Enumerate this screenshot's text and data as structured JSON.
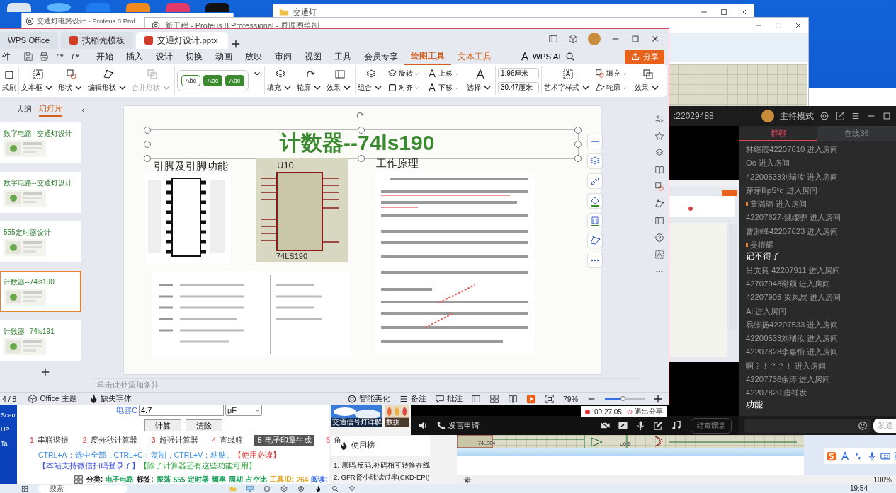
{
  "back_windows": [
    {
      "title": "交通灯电路设计 - Proteus 8 Prof"
    },
    {
      "title": "交通灯"
    },
    {
      "title": "新工程 - Proteus 8 Professional - 原理图绘制"
    }
  ],
  "desktop": {
    "icons": [
      {
        "label": "Scan"
      },
      {
        "label": "HP"
      },
      {
        "label": "Ta"
      }
    ]
  },
  "wps": {
    "tabs": [
      {
        "label": "WPS Office",
        "selected": false
      },
      {
        "label": "找稻壳模板",
        "selected": false
      },
      {
        "label": "交通灯设计.pptx",
        "selected": true
      }
    ],
    "file_menu": "件",
    "menu": [
      {
        "label": "开始",
        "kind": "normal",
        "selected": false
      },
      {
        "label": "插入",
        "kind": "normal",
        "selected": false
      },
      {
        "label": "设计",
        "kind": "normal",
        "selected": false
      },
      {
        "label": "切换",
        "kind": "normal",
        "selected": false
      },
      {
        "label": "动画",
        "kind": "normal",
        "selected": false
      },
      {
        "label": "放映",
        "kind": "normal",
        "selected": false
      },
      {
        "label": "审阅",
        "kind": "normal",
        "selected": false
      },
      {
        "label": "视图",
        "kind": "normal",
        "selected": false
      },
      {
        "label": "工具",
        "kind": "normal",
        "selected": false
      },
      {
        "label": "会员专享",
        "kind": "normal",
        "selected": false
      },
      {
        "label": "绘图工具",
        "kind": "context",
        "selected": true
      },
      {
        "label": "文本工具",
        "kind": "context",
        "selected": false
      }
    ],
    "ai_label": "WPS AI",
    "share": "分享",
    "ribbon": [
      {
        "items": [
          {
            "kind": "large",
            "label": "式刷",
            "menu": false,
            "disabled": false
          }
        ]
      },
      {
        "items": [
          {
            "kind": "large",
            "label": "文本框",
            "menu": true,
            "disabled": false
          },
          {
            "kind": "large",
            "label": "形状",
            "menu": true,
            "disabled": false
          },
          {
            "kind": "large",
            "label": "编辑形状",
            "menu": true,
            "disabled": false
          },
          {
            "kind": "large",
            "label": "合并形状",
            "menu": true,
            "disabled": true
          }
        ]
      },
      {
        "items": [
          {
            "kind": "style",
            "label": "Abc"
          },
          {
            "kind": "style",
            "label": "Abc"
          },
          {
            "kind": "style",
            "label": "Abc"
          }
        ]
      },
      {
        "items": [
          {
            "kind": "large",
            "label": "填充",
            "menu": true,
            "disabled": false
          },
          {
            "kind": "large",
            "label": "轮廓",
            "menu": true,
            "disabled": false
          },
          {
            "kind": "large",
            "label": "效果",
            "menu": true,
            "disabled": false
          }
        ]
      },
      {
        "items": [
          {
            "kind": "large",
            "label": "组合",
            "menu": true,
            "disabled": false
          },
          {
            "kind": "small",
            "label": "旋转",
            "menu": true,
            "disabled": false
          },
          {
            "kind": "small",
            "label": "对齐",
            "menu": true,
            "disabled": false
          },
          {
            "kind": "small",
            "label": "上移",
            "menu": true,
            "disabled": false
          },
          {
            "kind": "small",
            "label": "下移",
            "menu": true,
            "disabled": false
          },
          {
            "kind": "large",
            "label": "选择",
            "menu": true,
            "disabled": false
          }
        ]
      },
      {
        "items": [
          {
            "kind": "field",
            "value": "1.96厘米"
          },
          {
            "kind": "field",
            "value": "30.47厘米"
          }
        ]
      },
      {
        "items": [
          {
            "kind": "large",
            "label": "艺术字样式",
            "menu": true,
            "disabled": false
          },
          {
            "kind": "small",
            "label": "填充",
            "menu": true,
            "disabled": false
          },
          {
            "kind": "small",
            "label": "轮廓",
            "menu": true,
            "disabled": false
          },
          {
            "kind": "large",
            "label": "效果",
            "menu": true,
            "disabled": false
          }
        ]
      }
    ],
    "panel_tabs": [
      {
        "label": "大纲",
        "selected": false
      },
      {
        "label": "幻灯片",
        "selected": true
      }
    ],
    "thumbnails": [
      {
        "title": "数字电路--交通灯设计",
        "selected": false
      },
      {
        "title": "数字电路--交通灯设计",
        "selected": false
      },
      {
        "title": "555定时器设计",
        "selected": false
      },
      {
        "title": "计数器--74ls190",
        "selected": true
      },
      {
        "title": "计数器--74ls191",
        "selected": false
      }
    ],
    "slide": {
      "title": "计数器--74ls190",
      "left_heading": "引脚及引脚功能",
      "right_heading": "工作原理",
      "chip_label": "U10",
      "chip_part": "74LS190"
    },
    "notes_placeholder": "单击此处添加备注",
    "status": {
      "page": "4 / 8",
      "theme": "Office 主题",
      "font_warning": "缺失字体",
      "beautify": "智能美化",
      "notes": "备注",
      "comments": "批注",
      "zoom": "79%",
      "zoom_slider": {
        "level": 0.45
      }
    }
  },
  "meeting": {
    "room": ":22029488",
    "mode": "主持模式",
    "tabs": [
      {
        "label": "群聊",
        "selected": true
      },
      {
        "label": "在线36",
        "selected": false
      }
    ],
    "messages": [
      {
        "kind": "join",
        "text": "林继霞42207610 进入房间",
        "flagged": false
      },
      {
        "kind": "join",
        "text": "Oo 进入房间",
        "flagged": false
      },
      {
        "kind": "join",
        "text": "42200533刘瑞汝 进入房间",
        "flagged": false
      },
      {
        "kind": "join",
        "text": "芽芽ⅢpSᶜq 进入房间",
        "flagged": false
      },
      {
        "kind": "join",
        "text": "董璐璐 进入房间",
        "flagged": true
      },
      {
        "kind": "join",
        "text": "42207627-魏缨骅 进入房间",
        "flagged": false
      },
      {
        "kind": "join",
        "text": "曹源峰42207623 进入房间",
        "flagged": false
      },
      {
        "kind": "chat",
        "text": "吴櫂耀",
        "message": "记不得了",
        "flagged": true
      },
      {
        "kind": "join",
        "text": "吕文良 42207911 进入房间",
        "flagged": false
      },
      {
        "kind": "join",
        "text": "42707948谢颖 进入房间",
        "flagged": false
      },
      {
        "kind": "join",
        "text": "42207903-梁凤展 进入房间",
        "flagged": false
      },
      {
        "kind": "join",
        "text": "Ai 进入房间",
        "flagged": false
      },
      {
        "kind": "join",
        "text": "易张扬42207533 进入房间",
        "flagged": false
      },
      {
        "kind": "join",
        "text": "42200533刘瑞汝 进入房间",
        "flagged": false
      },
      {
        "kind": "join",
        "text": "42207828李嘉怡 进入房间",
        "flagged": false
      },
      {
        "kind": "join",
        "text": "啊？！？？！ 进入房间",
        "flagged": false
      },
      {
        "kind": "join",
        "text": "42207736余涛 进入房间",
        "flagged": false
      },
      {
        "kind": "chat",
        "text": "42207820 唐祥发",
        "message": "功能",
        "flagged": false
      }
    ],
    "timer": "00:27:05",
    "stop_share": "退出分享",
    "speak": "发言申请",
    "end_class": "结束课堂",
    "send": "发送"
  },
  "browser": {
    "field_label": "电容C",
    "field_value": "4.7",
    "unit": "μF",
    "buttons": [
      "计算",
      "清除"
    ],
    "tools": [
      {
        "num": "1",
        "label": "串联谐振",
        "selected": false
      },
      {
        "num": "2",
        "label": "度分秒计算器",
        "selected": false
      },
      {
        "num": "3",
        "label": "超强计算器",
        "selected": false
      },
      {
        "num": "4",
        "label": "直线筛",
        "selected": false
      },
      {
        "num": "5",
        "label": "电子印章生成",
        "selected": true
      },
      {
        "num": "6",
        "label": "角",
        "selected": false
      }
    ],
    "hint": "CTRL+A：选中全部，CTRL+C：复制，CTRL+V：粘贴。",
    "hint_links": [
      {
        "text": "【使用必读】",
        "kind": "notice"
      },
      {
        "text": "【本站支持微信扫码登录了】",
        "kind": "wechat"
      },
      {
        "text": "【除了计算器还有这些功能可用】",
        "kind": "feature"
      }
    ],
    "meta": [
      {
        "text": "分类:",
        "kind": "label"
      },
      {
        "text": "电子电路",
        "kind": "link"
      },
      {
        "text": "标签:",
        "kind": "label"
      },
      {
        "text": "振荡",
        "kind": "link"
      },
      {
        "text": "555",
        "kind": "link"
      },
      {
        "text": "定时器",
        "kind": "link"
      },
      {
        "text": "频率",
        "kind": "link"
      },
      {
        "text": "周期",
        "kind": "link"
      },
      {
        "text": "占空比",
        "kind": "link"
      },
      {
        "text": "工具ID:",
        "kind": "id"
      },
      {
        "text": "264",
        "kind": "id"
      },
      {
        "text": "阅读:",
        "kind": "read"
      }
    ],
    "tiles": [
      "交通信号灯详解",
      "数据"
    ],
    "ranking_title": "使用榜",
    "ranking": [
      "1. 原码,反码,补码相互转换在线",
      "2. GFR肾小球滤过率(CKD-EPI)"
    ]
  },
  "schematic": {
    "labels": [
      "74LS04",
      "U6:B"
    ],
    "status_left": "素",
    "status_zoom": "100%"
  },
  "taskbar": {
    "search": "搜索",
    "time": "19:54"
  }
}
